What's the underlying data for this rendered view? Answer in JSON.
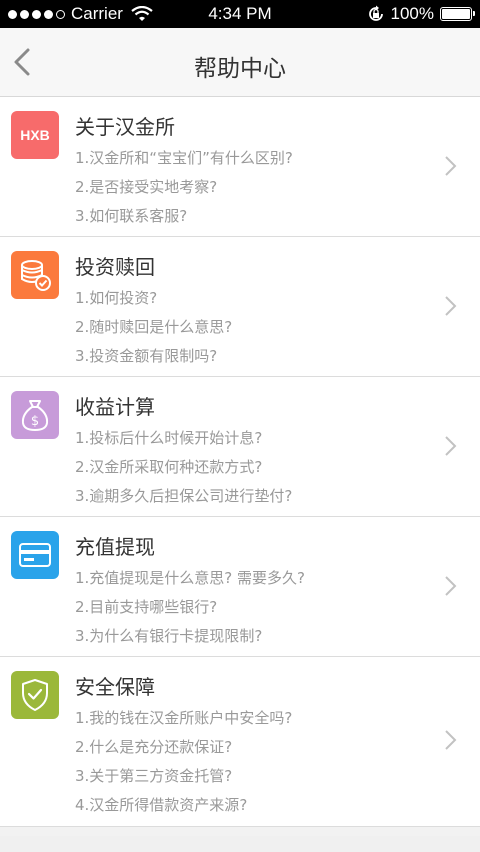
{
  "status_bar": {
    "carrier": "Carrier",
    "time": "4:34 PM",
    "battery": "100%",
    "battery_level": 1.0
  },
  "nav": {
    "title": "帮助中心"
  },
  "colors": {
    "about": "#f76b6b",
    "invest": "#fb7a3d",
    "income": "#c79bd9",
    "recharge": "#2aa3ea",
    "security": "#9bb83a"
  },
  "sections": [
    {
      "id": "about",
      "icon": "hxb-logo-icon",
      "icon_text": "HXB",
      "title": "关于汉金所",
      "questions": [
        "1.汉金所和“宝宝们”有什么区别?",
        "2.是否接受实地考察?",
        "3.如何联系客服?"
      ]
    },
    {
      "id": "invest",
      "icon": "coin-stack-icon",
      "title": "投资赎回",
      "questions": [
        "1.如何投资?",
        "2.随时赎回是什么意思?",
        "3.投资金额有限制吗?"
      ]
    },
    {
      "id": "income",
      "icon": "money-bag-icon",
      "title": "收益计算",
      "questions": [
        "1.投标后什么时候开始计息?",
        "2.汉金所采取何种还款方式?",
        "3.逾期多久后担保公司进行垫付?"
      ]
    },
    {
      "id": "recharge",
      "icon": "bank-card-icon",
      "title": "充值提现",
      "questions": [
        "1.充值提现是什么意思? 需要多久?",
        "2.目前支持哪些银行?",
        "3.为什么有银行卡提现限制?"
      ]
    },
    {
      "id": "security",
      "icon": "shield-check-icon",
      "title": "安全保障",
      "questions": [
        "1.我的钱在汉金所账户中安全吗?",
        "2.什么是充分还款保证?",
        "3.关于第三方资金托管?",
        "4.汉金所得借款资产来源?"
      ]
    }
  ]
}
